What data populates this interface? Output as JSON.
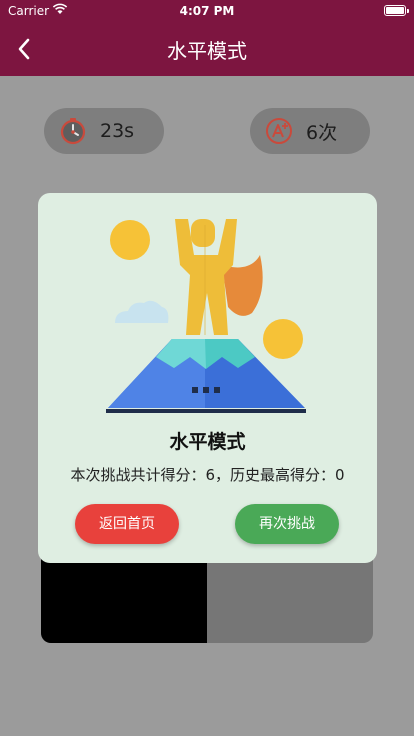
{
  "status_bar": {
    "carrier": "Carrier",
    "time": "4:07 PM"
  },
  "nav": {
    "title": "水平模式",
    "back_icon": "chevron-left-icon"
  },
  "stats": {
    "time_value": "23s",
    "time_icon": "stopwatch-icon",
    "count_value": "6次",
    "count_icon": "grade-a-plus-icon"
  },
  "modal": {
    "illustration": "mountain-hero-icon",
    "title": "水平模式",
    "score_text": "本次挑战共计得分：6，历史最高得分：0",
    "home_button": "返回首页",
    "again_button": "再次挑战"
  },
  "colors": {
    "nav_bg": "#7d1540",
    "home_button": "#e8413c",
    "again_button": "#4aa957",
    "modal_bg": "#dfeee2"
  }
}
